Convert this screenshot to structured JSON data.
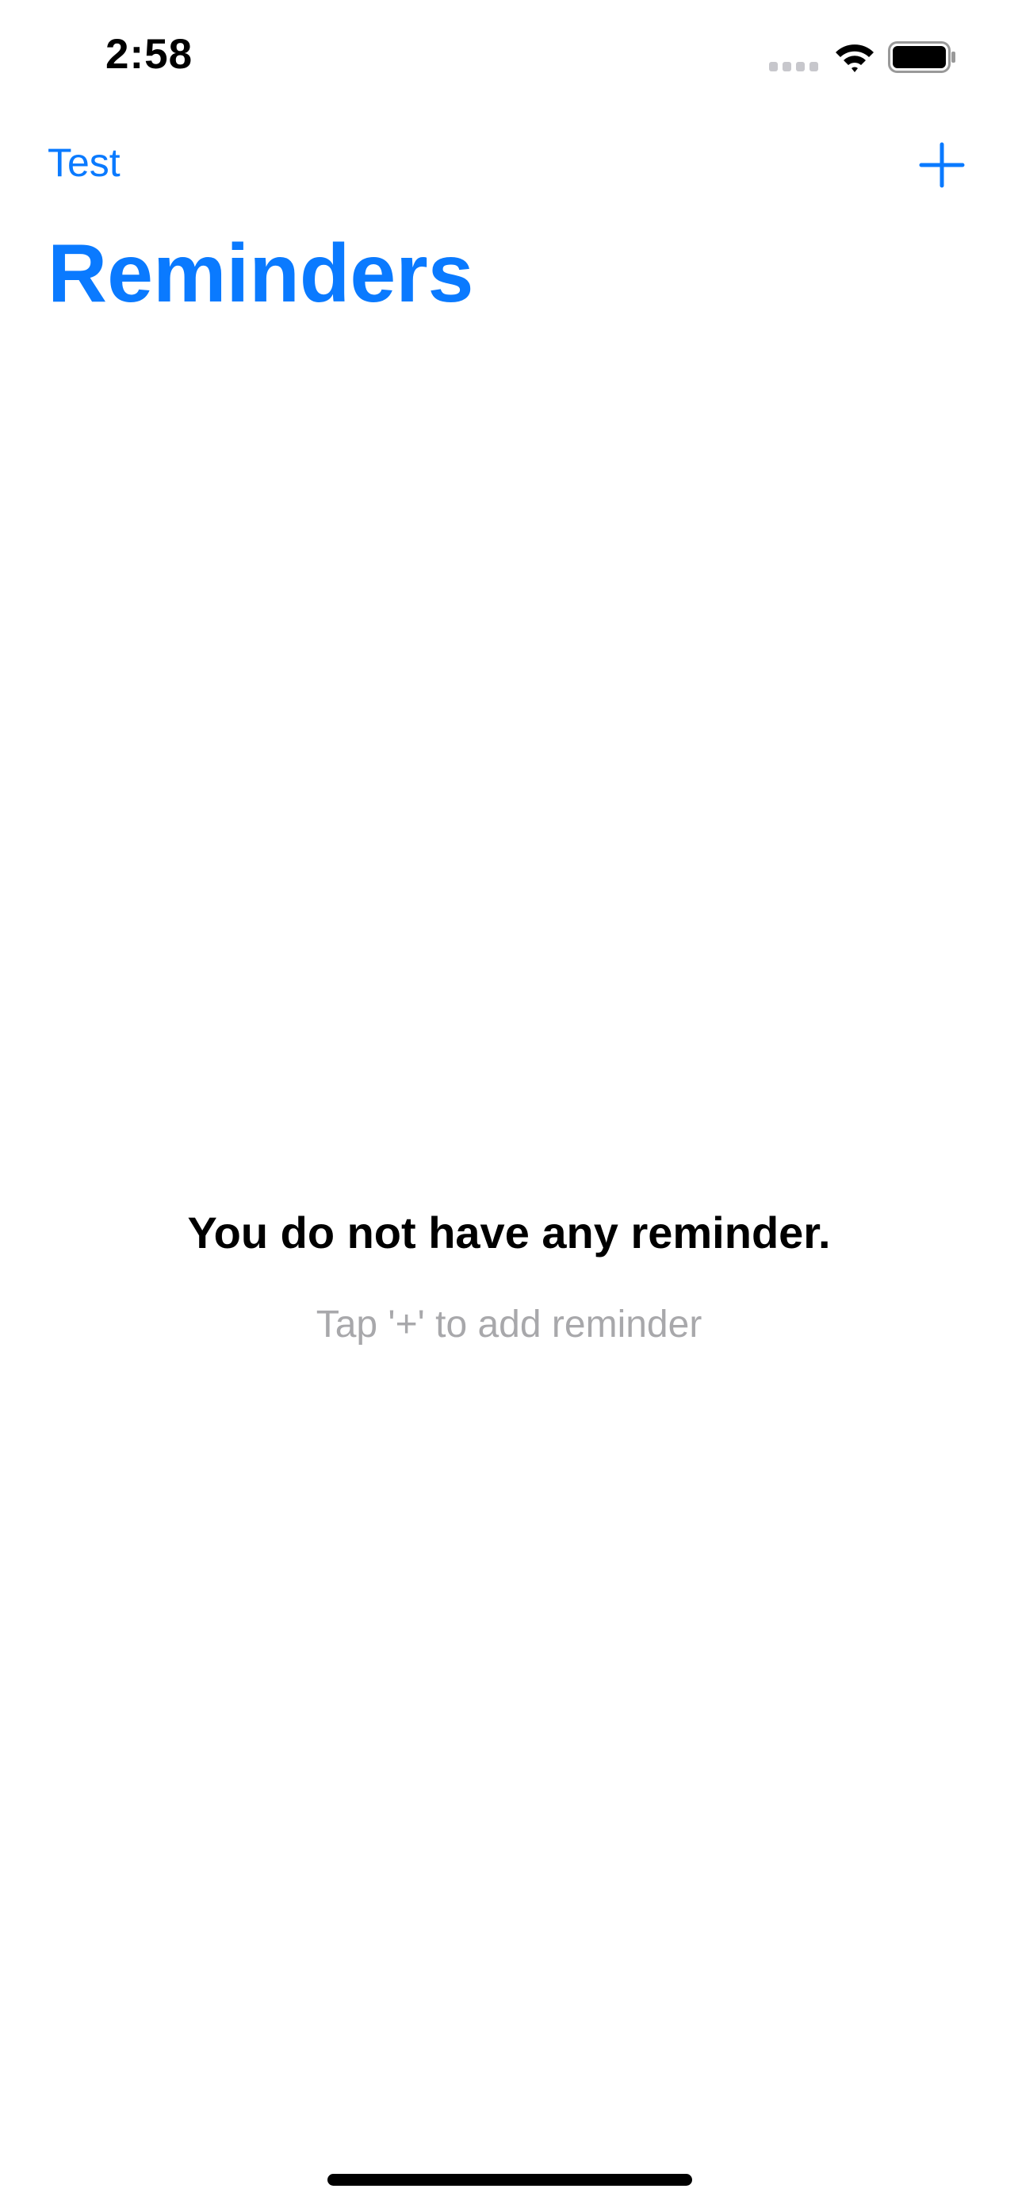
{
  "status_bar": {
    "time": "2:58"
  },
  "nav": {
    "left_label": "Test",
    "add_icon": "plus-icon"
  },
  "page": {
    "title": "Reminders"
  },
  "empty_state": {
    "title": "You do not have any reminder.",
    "subtitle": "Tap '+' to add reminder"
  },
  "colors": {
    "accent": "#0a7aff",
    "subtitle": "#a8a8ab"
  }
}
